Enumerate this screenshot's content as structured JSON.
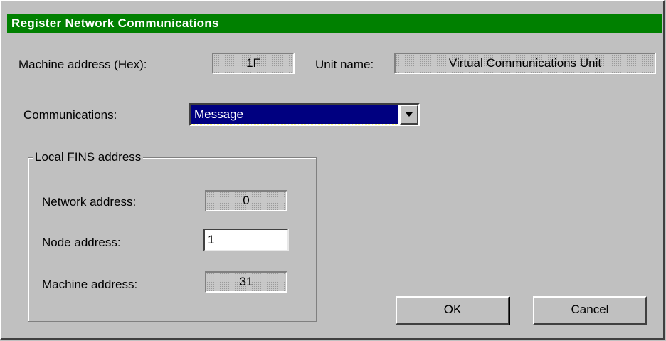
{
  "dialog": {
    "title": "Register Network Communications",
    "machine_address_hex_label": "Machine address (Hex):",
    "machine_address_hex_value": "1F",
    "unit_name_label": "Unit name:",
    "unit_name_value": "Virtual Communications Unit",
    "communications_label": "Communications:",
    "communications_value": "Message"
  },
  "local_fins": {
    "group_label": "Local FINS address",
    "network_address_label": "Network address:",
    "network_address_value": "0",
    "node_address_label": "Node address:",
    "node_address_value": "1",
    "machine_address_label": "Machine address:",
    "machine_address_value": "31"
  },
  "buttons": {
    "ok_label": "OK",
    "cancel_label": "Cancel"
  },
  "icons": {
    "dropdown": "chevron-down-icon"
  }
}
